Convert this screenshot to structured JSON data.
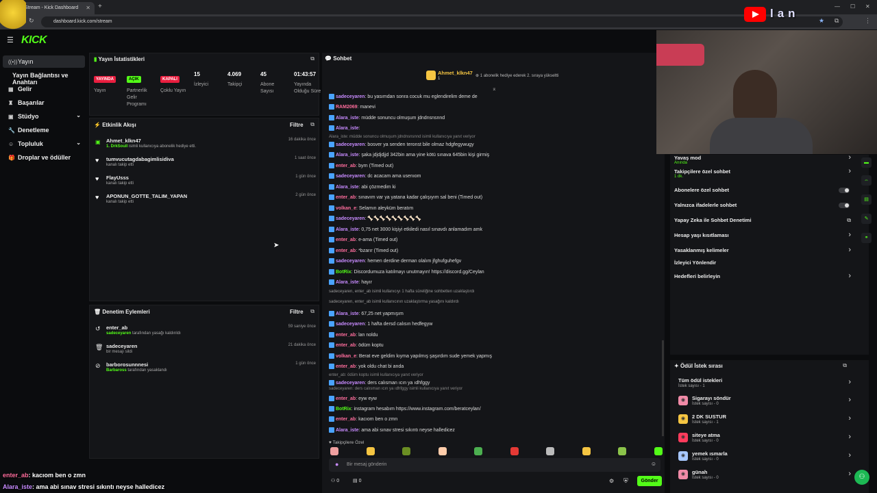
{
  "browser": {
    "tab_title": "Stream - Kick Dashboard",
    "url": "dashboard.kick.com/stream"
  },
  "brand": {
    "logo": "KICK",
    "accent": "#53fc18"
  },
  "sidebar": {
    "items": [
      {
        "label": "Yayın",
        "icon": "broadcast-icon",
        "active": true
      },
      {
        "label": "Yayın Bağlantısı ve Anahtarı",
        "icon": "",
        "active": false
      },
      {
        "label": "Gelir",
        "icon": "money-icon",
        "active": false
      },
      {
        "label": "Başarılar",
        "icon": "trophy-icon",
        "active": false
      },
      {
        "label": "Stüdyo",
        "icon": "studio-icon",
        "active": false
      },
      {
        "label": "Denetleme",
        "icon": "wrench-icon",
        "active": false
      },
      {
        "label": "Topluluk",
        "icon": "community-icon",
        "active": false
      },
      {
        "label": "Droplar ve ödüller",
        "icon": "gift-icon",
        "active": false
      }
    ]
  },
  "stats": {
    "title": "Yayın İstatistikleri",
    "items": [
      {
        "badge": "YAYINDA",
        "label": "Yayın"
      },
      {
        "badge": "AÇIK",
        "label": "Partnerlik Gelir Programı"
      },
      {
        "badge": "KAPALI",
        "label": "Çoklu Yayın"
      },
      {
        "value": "15",
        "label": "İzleyici"
      },
      {
        "value": "4.069",
        "label": "Takipçi"
      },
      {
        "value": "45",
        "label": "Abone Sayısı"
      },
      {
        "value": "01:43:57",
        "label": "Yayında Olduğu Süre"
      }
    ]
  },
  "activity": {
    "title": "Etkinlik Akışı",
    "filter": "Filtre",
    "events": [
      {
        "name": "Ahmet_klkn47",
        "sub_highlight": "1. DrkSoull",
        "sub": " isimli kullanıcıya abonelik hediye etti.",
        "time": "16 dakika önce"
      },
      {
        "name": "tumvucutagdabagimlisidiva",
        "sub_highlight": "",
        "sub": "kanalı takip etti",
        "time": "1 saat önce"
      },
      {
        "name": "FlayUsss",
        "sub_highlight": "",
        "sub": "kanalı takip etti",
        "time": "1 gün önce"
      },
      {
        "name": "APONUN_GOTTE_TALIM_YAPAN",
        "sub_highlight": "",
        "sub": "kanalı takip etti",
        "time": "2 gün önce"
      }
    ]
  },
  "moderation": {
    "title": "Denetim Eylemleri",
    "filter": "Filtre",
    "events": [
      {
        "name": "enter_ab",
        "sub_highlight": "sadeceyaren",
        "sub": " tarafından yasağı kaldırıldı",
        "time": "59 saniye önce"
      },
      {
        "name": "sadeceyaren",
        "sub_highlight": "",
        "sub": "bir mesajı sildi",
        "time": "21 dakika önce"
      },
      {
        "name": "barborosunnnesi",
        "sub_highlight": "Barbaross",
        "sub": " tarafından yasaklandı",
        "time": "1 gün önce"
      }
    ]
  },
  "chat": {
    "title": "Sohbet",
    "pinned_user": "Ahmet_klkn47",
    "pinned_count": "1",
    "pinned_text": "1 abonelik hediye ederek 2. sıraya yükseltti",
    "messages": [
      {
        "user": "sadeceyaren",
        "color": "#c88bff",
        "text": "bu yasımdan sonra cocuk mu eglendirelim deme de"
      },
      {
        "user": "RAM2069",
        "color": "#ff6d9d",
        "text": "manevi"
      },
      {
        "user": "Alara_iste",
        "color": "#c88bff",
        "text": "müdde sonuncu olmuşum jdndnsnsnnd"
      },
      {
        "user": "Alara_iste",
        "color": "#c88bff",
        "text": ""
      },
      {
        "user": "",
        "color": "#888",
        "text": "Alara_iste: müdde sonuncu olmuşum jdndnsnsnnd isimli kullanıcıya yanıt veriyor"
      },
      {
        "user": "sadeceyaren",
        "color": "#c88bff",
        "text": "bosver ya senden teronst bile olmaz hdgfegywugy"
      },
      {
        "user": "Alara_iste",
        "color": "#c88bff",
        "text": "şaka jdjdjdjjd 342bin ama yine kötü sınava 645bin kişi girmiş"
      },
      {
        "user": "enter_ab",
        "color": "#ff6d9d",
        "text": "byrn (Timed out)"
      },
      {
        "user": "sadeceyaren",
        "color": "#c88bff",
        "text": "dc acacam ama usenıom"
      },
      {
        "user": "Alara_iste",
        "color": "#c88bff",
        "text": "abi çözmedim ki"
      },
      {
        "user": "enter_ab",
        "color": "#ff6d9d",
        "text": "sınavım var ya yatana kadar çalışıyım sal beni (Timed out)"
      },
      {
        "user": "volkan_e",
        "color": "#ff6d9d",
        "text": "Selamın aleyküm beratım"
      },
      {
        "user": "sadeceyaren",
        "color": "#c88bff",
        "text": "🦴🦴🦴🦴🦴🦴🦴🦴🦴"
      },
      {
        "user": "Alara_iste",
        "color": "#c88bff",
        "text": "0,75 net 3000 kişiyi etkiledi nasıl sınavdı anlamadım amk"
      },
      {
        "user": "enter_ab",
        "color": "#ff6d9d",
        "text": "e-ama (Timed out)"
      },
      {
        "user": "enter_ab",
        "color": "#ff6d9d",
        "text": "*bzarır (Timed out)"
      },
      {
        "user": "sadeceyaren",
        "color": "#c88bff",
        "text": "hemen derdine derman olalım jfghufguhefgv"
      },
      {
        "user": "BotRix",
        "color": "#53fc18",
        "text": "Discordumuza katılmayı unutmayın! https://discord.gg/Ceylan"
      },
      {
        "user": "Alara_iste",
        "color": "#c88bff",
        "text": "hayır"
      },
      {
        "user": "",
        "color": "#999",
        "text": "sadeceyaren, enter_ab isimli kullanıcıyı 1 hafta süreliğine sohbetten uzaklaştırdı"
      },
      {
        "user": "",
        "color": "#999",
        "text": "sadeceyaren, enter_ab isimli kullanıcının uzaklaştırma yasağını kaldırdı"
      },
      {
        "user": "Alara_iste",
        "color": "#c88bff",
        "text": "67,25 net yapmışım"
      },
      {
        "user": "sadeceyaren",
        "color": "#c88bff",
        "text": "1 hafta dersd calısın hedfegyw"
      },
      {
        "user": "enter_ab",
        "color": "#ff6d9d",
        "text": "lan noldu"
      },
      {
        "user": "enter_ab",
        "color": "#ff6d9d",
        "text": "ödüm koptu"
      },
      {
        "user": "volkan_e",
        "color": "#ff6d9d",
        "text": "Berat eve geldim kıyma yapılmış şaşırdım sude yemek yapmış"
      },
      {
        "user": "enter_ab",
        "color": "#ff6d9d",
        "text": "yok oldu chat bi anda"
      },
      {
        "user": "",
        "color": "#888",
        "text": "enter_ab: ödüm koptu isimli kullanıcıya yanıt veriyor"
      },
      {
        "user": "sadeceyaren",
        "color": "#c88bff",
        "text": "ders calısman ıcın ya ıdhfggy"
      },
      {
        "user": "",
        "color": "#888",
        "text": "sadeceyaren: ders calısman ıcın ya ıdhfggy isimli kullanıcıya yanıt veriyor"
      },
      {
        "user": "enter_ab",
        "color": "#ff6d9d",
        "text": "eyw eyw"
      },
      {
        "user": "BotRix",
        "color": "#53fc18",
        "text": "instagram hesabım https://www.instagram.com/beratceylan/"
      },
      {
        "user": "enter_ab",
        "color": "#ff6d9d",
        "text": "kacıom ben o zmn"
      },
      {
        "user": "Alara_iste",
        "color": "#c88bff",
        "text": "ama abi sınav stresi sıkıntı neyse halledicez"
      }
    ],
    "emote_section": "Takipçilere Özel",
    "input_placeholder": "Bir mesaj gönderin",
    "send_label": "Gönder",
    "footer_left": "0",
    "footer_mid": "0"
  },
  "chat_settings": {
    "items": [
      {
        "label": "Yavaş mod",
        "sub": "Anında",
        "control": "arrow"
      },
      {
        "label": "Takipçilere özel sohbet",
        "sub": "1 dk.",
        "control": "arrow"
      },
      {
        "label": "Abonelere özel sohbet",
        "sub": "",
        "control": "toggle"
      },
      {
        "label": "Yalnızca ifadelerle sohbet",
        "sub": "",
        "control": "toggle"
      },
      {
        "label": "Yapay Zeka ile Sohbet Denetimi",
        "sub": "",
        "control": "external"
      },
      {
        "label": "Hesap yaşı kısıtlaması",
        "sub": "",
        "control": "arrow"
      },
      {
        "label": "Yasaklanmış kelimeler",
        "sub": "",
        "control": "arrow"
      },
      {
        "label": "İzleyici Yönlendir",
        "sub": "",
        "control": "none"
      },
      {
        "label": "Hedefleri belirleyin",
        "sub": "",
        "control": "arrow"
      }
    ]
  },
  "rewards": {
    "title": "Ödül İstek sırası",
    "all_label": "Tüm ödül istekleri",
    "all_sub": "İstek sayısı - 1",
    "items": [
      {
        "name": "Sigarayı söndür",
        "sub": "İstek sayısı - 0",
        "color": "#f08aa7"
      },
      {
        "name": "2 DK SUSTUR",
        "sub": "İstek sayısı - 1",
        "color": "#f5c542"
      },
      {
        "name": "siteye atma",
        "sub": "İstek sayısı - 0",
        "color": "#ff3b5c"
      },
      {
        "name": "yemek ısmarla",
        "sub": "İstek sayısı - 0",
        "color": "#a7c7ff"
      },
      {
        "name": "günah",
        "sub": "İstek sayısı - 0",
        "color": "#f08aa7"
      }
    ]
  },
  "overlay": {
    "yt_text": "lan",
    "line1_user": "enter_ab",
    "line1_text": ": kacıom ben o zmn",
    "line2_user": "Alara_iste",
    "line2_text": ": ama abi sınav stresi sıkıntı neyse halledicez"
  }
}
